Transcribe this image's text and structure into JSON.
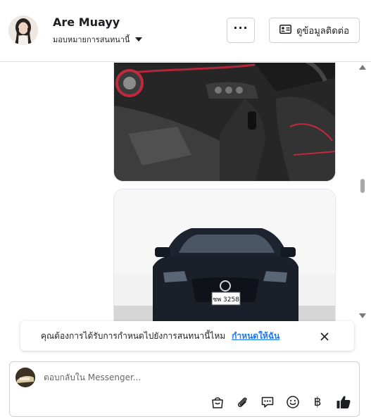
{
  "header": {
    "name": "Are Muayy",
    "assign_label": "มอบหมายการสนทนานี้",
    "more_label": "···",
    "contact_label": "ดูข้อมูลติดต่อ"
  },
  "chat": {
    "plate_text": "ชพ 3258"
  },
  "notice": {
    "text": "คุณต้องการได้รับการกำหนดไปยังการสนทนานี้ไหม",
    "link": "กำหนดให้ฉัน"
  },
  "composer": {
    "placeholder": "ตอบกลับใน Messenger..."
  },
  "icons": {
    "more": "more-dots-icon",
    "contact": "contact-card-icon",
    "close": "close-icon",
    "bag": "shopping-bag-icon",
    "attach": "paperclip-icon",
    "saved": "saved-reply-icon",
    "emoji": "emoji-icon",
    "baht": "baht-icon",
    "like": "thumbs-up-icon"
  },
  "tools": {
    "baht_symbol": "฿"
  },
  "colors": {
    "link": "#1877f2",
    "border": "#ccd0d5"
  }
}
